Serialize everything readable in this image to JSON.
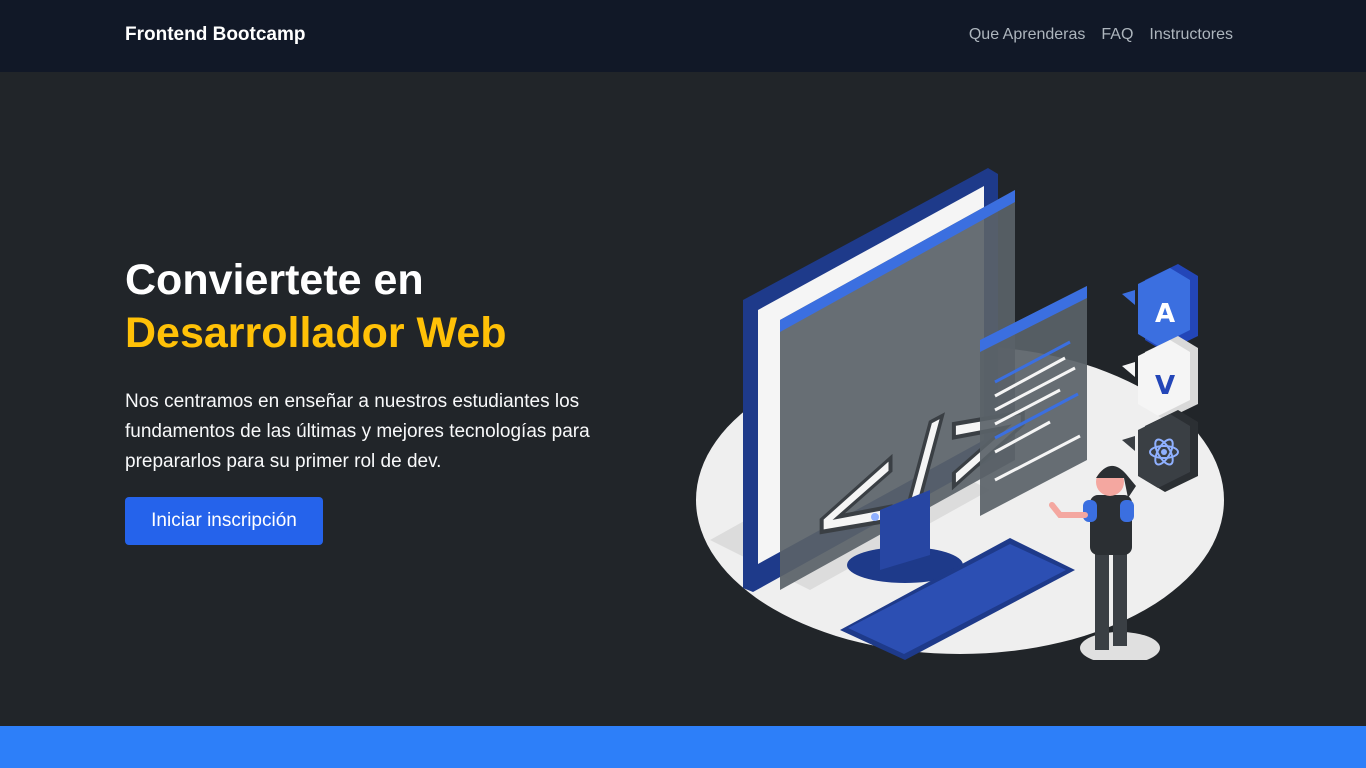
{
  "navbar": {
    "brand": "Frontend Bootcamp",
    "links": [
      "Que Aprenderas",
      "FAQ",
      "Instructores"
    ]
  },
  "hero": {
    "headline_line1": "Conviertete en",
    "headline_line2": "Desarrollador Web",
    "description": "Nos centramos en enseñar a nuestros estudiantes los fundamentos de las últimas y mejores tecnologías para prepararlos para su primer rol de dev.",
    "cta_label": "Iniciar inscripción",
    "illustration_code": "</>",
    "badges": [
      "A",
      "V"
    ]
  },
  "colors": {
    "navbar_bg": "#111827",
    "hero_bg": "#212529",
    "accent_yellow": "#ffc107",
    "button_blue": "#2563eb",
    "strip_blue": "#2d7ff9"
  }
}
